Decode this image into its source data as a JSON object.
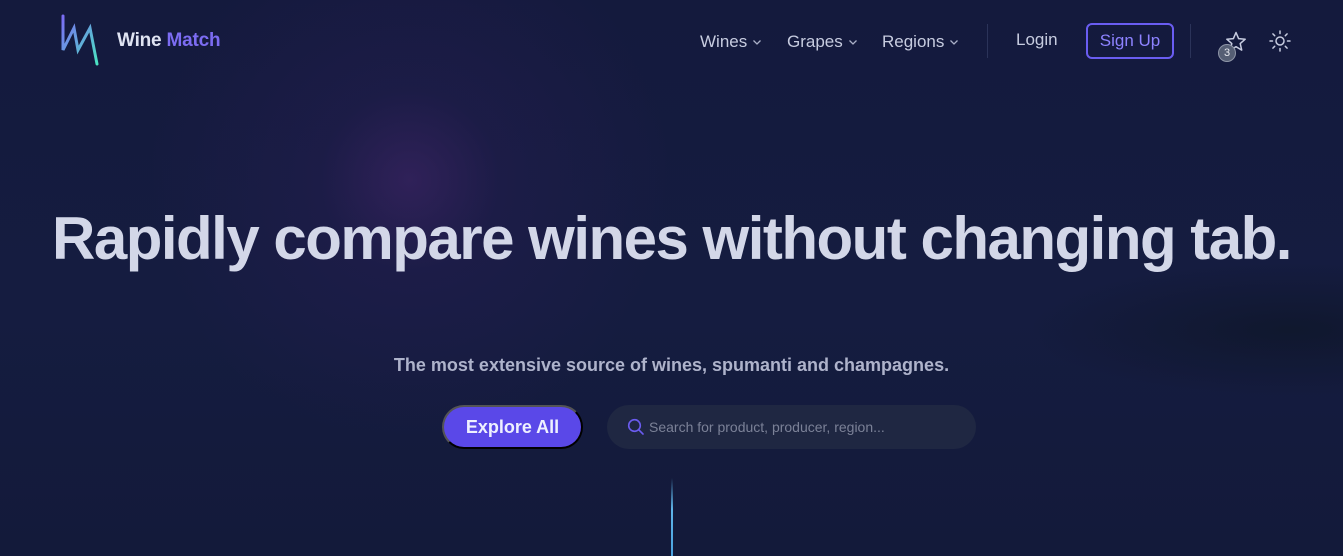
{
  "brand": {
    "name_part1": "Wine",
    "name_part2": "Match",
    "logo_icon": "wine-match-logo-icon"
  },
  "nav": {
    "items": [
      {
        "label": "Wines",
        "icon": "chevron-down-icon"
      },
      {
        "label": "Grapes",
        "icon": "chevron-down-icon"
      },
      {
        "label": "Regions",
        "icon": "chevron-down-icon"
      }
    ],
    "login_label": "Login",
    "signup_label": "Sign Up",
    "favorites": {
      "icon": "star-icon",
      "count": "3"
    },
    "theme_toggle_icon": "sun-icon"
  },
  "hero": {
    "title": "Rapidly compare wines without changing tab.",
    "subtitle": "The most extensive source of wines, spumanti and champagnes.",
    "explore_label": "Explore All",
    "search": {
      "placeholder": "Search for product, producer, region...",
      "value": "",
      "icon": "search-icon"
    }
  },
  "colors": {
    "background": "#131a3b",
    "accent": "#5a48e8",
    "brand_accent": "#7c6cf2",
    "logo_gradient_start": "#7b6cf5",
    "logo_gradient_end": "#4be3c2"
  }
}
